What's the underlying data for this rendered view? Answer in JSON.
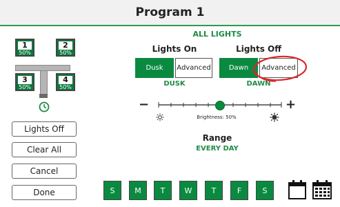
{
  "header": {
    "title": "Program 1"
  },
  "fixtures": [
    {
      "number": "1",
      "brightness": "50%"
    },
    {
      "number": "2",
      "brightness": "50%"
    },
    {
      "number": "3",
      "brightness": "50%"
    },
    {
      "number": "4",
      "brightness": "50%"
    }
  ],
  "sidebar": {
    "lights_off": "Lights Off",
    "clear_all": "Clear All",
    "cancel": "Cancel",
    "done": "Done"
  },
  "group": {
    "title": "ALL LIGHTS"
  },
  "lights_on": {
    "heading": "Lights On",
    "dusk_label": "Dusk",
    "advanced_label": "Advanced",
    "selected": "DUSK"
  },
  "lights_off": {
    "heading": "Lights Off",
    "dawn_label": "Dawn",
    "advanced_label": "Advanced",
    "selected": "DAWN"
  },
  "brightness": {
    "minus": "−",
    "plus": "+",
    "label": "Brightness: 50%",
    "level_percent": 50
  },
  "range": {
    "heading": "Range",
    "value": "EVERY DAY"
  },
  "days": [
    "S",
    "M",
    "T",
    "W",
    "T",
    "F",
    "S"
  ],
  "colors": {
    "accent_green": "#0a8a40",
    "header_rule": "#2e9a52",
    "annotation_red": "#d9262a"
  },
  "icons": {
    "timer": "clock-icon",
    "single_date": "calendar-day-icon",
    "date_range": "calendar-range-icon"
  }
}
